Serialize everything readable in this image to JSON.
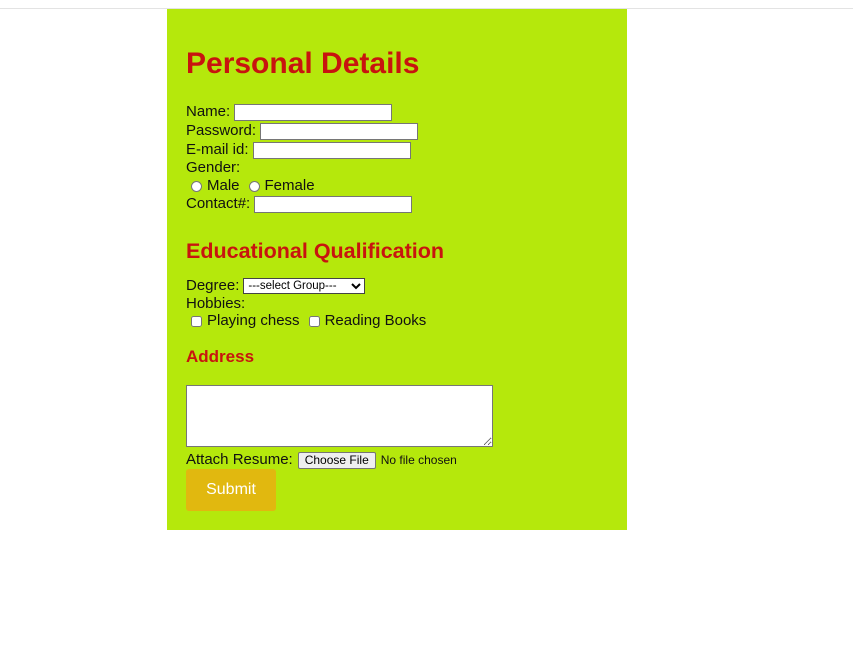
{
  "form": {
    "title": "Personal Details",
    "name_label": "Name:",
    "name_value": "",
    "password_label": "Password:",
    "password_value": "",
    "email_label": "E-mail id:",
    "email_value": "",
    "gender_label": "Gender:",
    "gender_options": [
      "Male",
      "Female"
    ],
    "contact_label": "Contact#:",
    "contact_value": ""
  },
  "education": {
    "title": "Educational Qualification",
    "degree_label": "Degree:",
    "degree_selected": "---select Group---",
    "hobbies_label": "Hobbies:",
    "hobbies": [
      "Playing chess",
      "Reading Books"
    ]
  },
  "address": {
    "title": "Address",
    "value": ""
  },
  "resume": {
    "label": "Attach Resume:",
    "button_label": "Choose File",
    "status": "No file chosen"
  },
  "submit_label": "Submit",
  "colors": {
    "panel_bg": "#b5e80c",
    "heading": "#c8140f",
    "submit_bg": "#e1b80f"
  }
}
